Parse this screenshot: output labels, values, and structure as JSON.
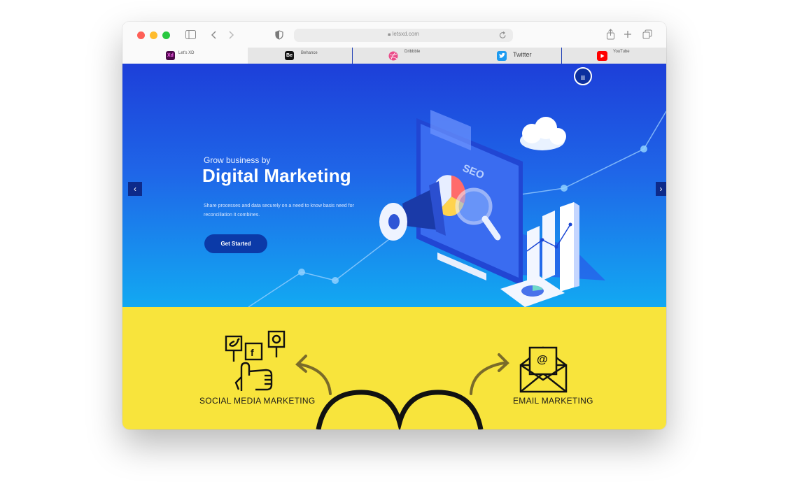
{
  "browser": {
    "url": "letsxd.com",
    "icons": {
      "sidebar": "sidebar-icon",
      "back": "back-icon",
      "forward": "forward-icon",
      "privacy": "shield-icon",
      "reload": "reload-icon",
      "share": "share-icon",
      "new_tab": "plus-icon",
      "tab_overview": "tabs-icon",
      "lock": "lock-icon"
    },
    "tabs": [
      {
        "label": "Let's XD",
        "favicon": "Xd",
        "color": "#4d0a4a",
        "active": true
      },
      {
        "label": "Behance",
        "favicon": "Be",
        "color": "#111111",
        "active": false
      },
      {
        "label": "Dribbble",
        "favicon": "dribbble-icon",
        "color": "#ea4c89",
        "active": false
      },
      {
        "label": "Twitter",
        "favicon": "twitter-icon",
        "color": "#1d9bf0",
        "active": false
      },
      {
        "label": "YouTube",
        "favicon": "youtube-icon",
        "color": "#ff0000",
        "active": false
      }
    ]
  },
  "hero": {
    "subtitle": "Grow business by",
    "title": "Digital Marketing",
    "description": "Share processes and data securely on a need to know basis need for reconciliation it combines.",
    "cta_label": "Get Started",
    "prev_arrow": "‹",
    "next_arrow": "›",
    "menu_icon": "≡",
    "illustration_text": "SEO"
  },
  "section": {
    "left_label": "SOCIAL MEDIA MARKETING",
    "right_label": "EMAIL MARKETING",
    "social_f": "f"
  },
  "colors": {
    "accent": "#1d3fd9",
    "cta": "#0b3aa8",
    "yellow": "#f8e43c"
  }
}
